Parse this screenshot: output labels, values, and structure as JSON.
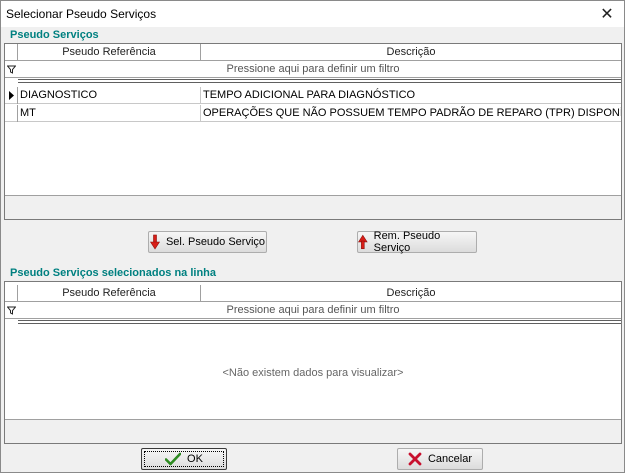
{
  "window": {
    "title": "Selecionar Pseudo Serviços",
    "close_glyph": "✕"
  },
  "top_grid": {
    "section_label": "Pseudo Serviços",
    "columns": [
      "Pseudo Referência",
      "Descrição"
    ],
    "filter_prompt": "Pressione aqui para definir um filtro",
    "rows": [
      {
        "ref": "DIAGNOSTICO",
        "desc": "TEMPO ADICIONAL PARA DIAGNÓSTICO"
      },
      {
        "ref": "MT",
        "desc": "OPERAÇÕES QUE NÃO POSSUEM TEMPO PADRÃO DE REPARO (TPR) DISPONÍVEL NO P"
      }
    ]
  },
  "actions": {
    "select_label": "Sel. Pseudo Serviço",
    "remove_label": "Rem. Pseudo Serviço"
  },
  "bottom_grid": {
    "section_label": "Pseudo Serviços selecionados na linha",
    "columns": [
      "Pseudo Referência",
      "Descrição"
    ],
    "filter_prompt": "Pressione aqui para definir um filtro",
    "empty_message": "<Não existem dados para visualizar>"
  },
  "footer": {
    "ok_label": "OK",
    "cancel_label": "Cancelar"
  },
  "colors": {
    "section_label": "#008080",
    "ok_check": "#2e8b22",
    "cancel_x": "#c8102e",
    "arrow": "#d91e18"
  }
}
